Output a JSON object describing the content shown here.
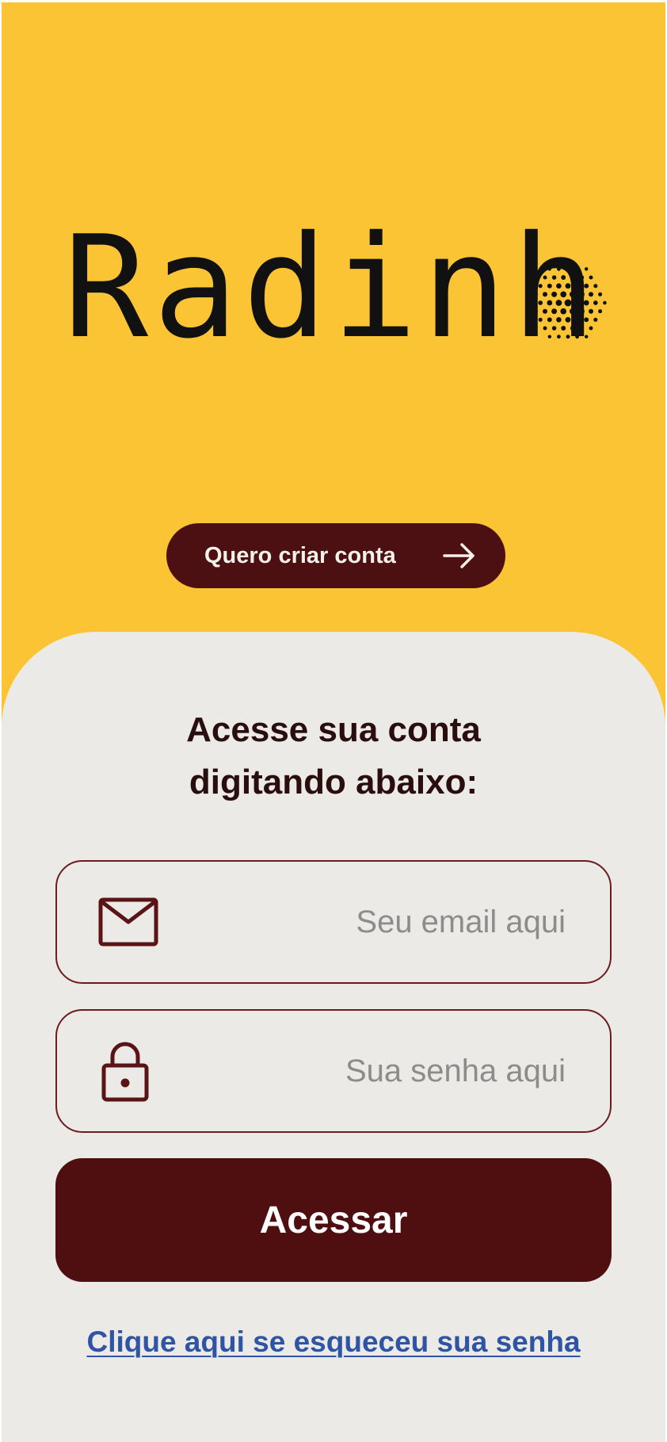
{
  "app": {
    "brand": "Radinho",
    "logo_text": "Radinh",
    "colors": {
      "primary_yellow": "#fbc434",
      "dark_maroon": "#4f0e0f",
      "panel_gray": "#ebeae6",
      "link_blue": "#2e54a3"
    }
  },
  "header": {
    "create_account_label": "Quero criar conta",
    "create_account_icon": "arrow-right-icon"
  },
  "login": {
    "heading_line1": "Acesse sua conta",
    "heading_line2": "digitando abaixo:",
    "email": {
      "icon": "mail-icon",
      "placeholder": "Seu email aqui",
      "value": ""
    },
    "password": {
      "icon": "lock-icon",
      "placeholder": "Sua senha aqui",
      "value": ""
    },
    "submit_label": "Acessar",
    "forgot_password_label": "Clique aqui se esqueceu sua senha"
  }
}
